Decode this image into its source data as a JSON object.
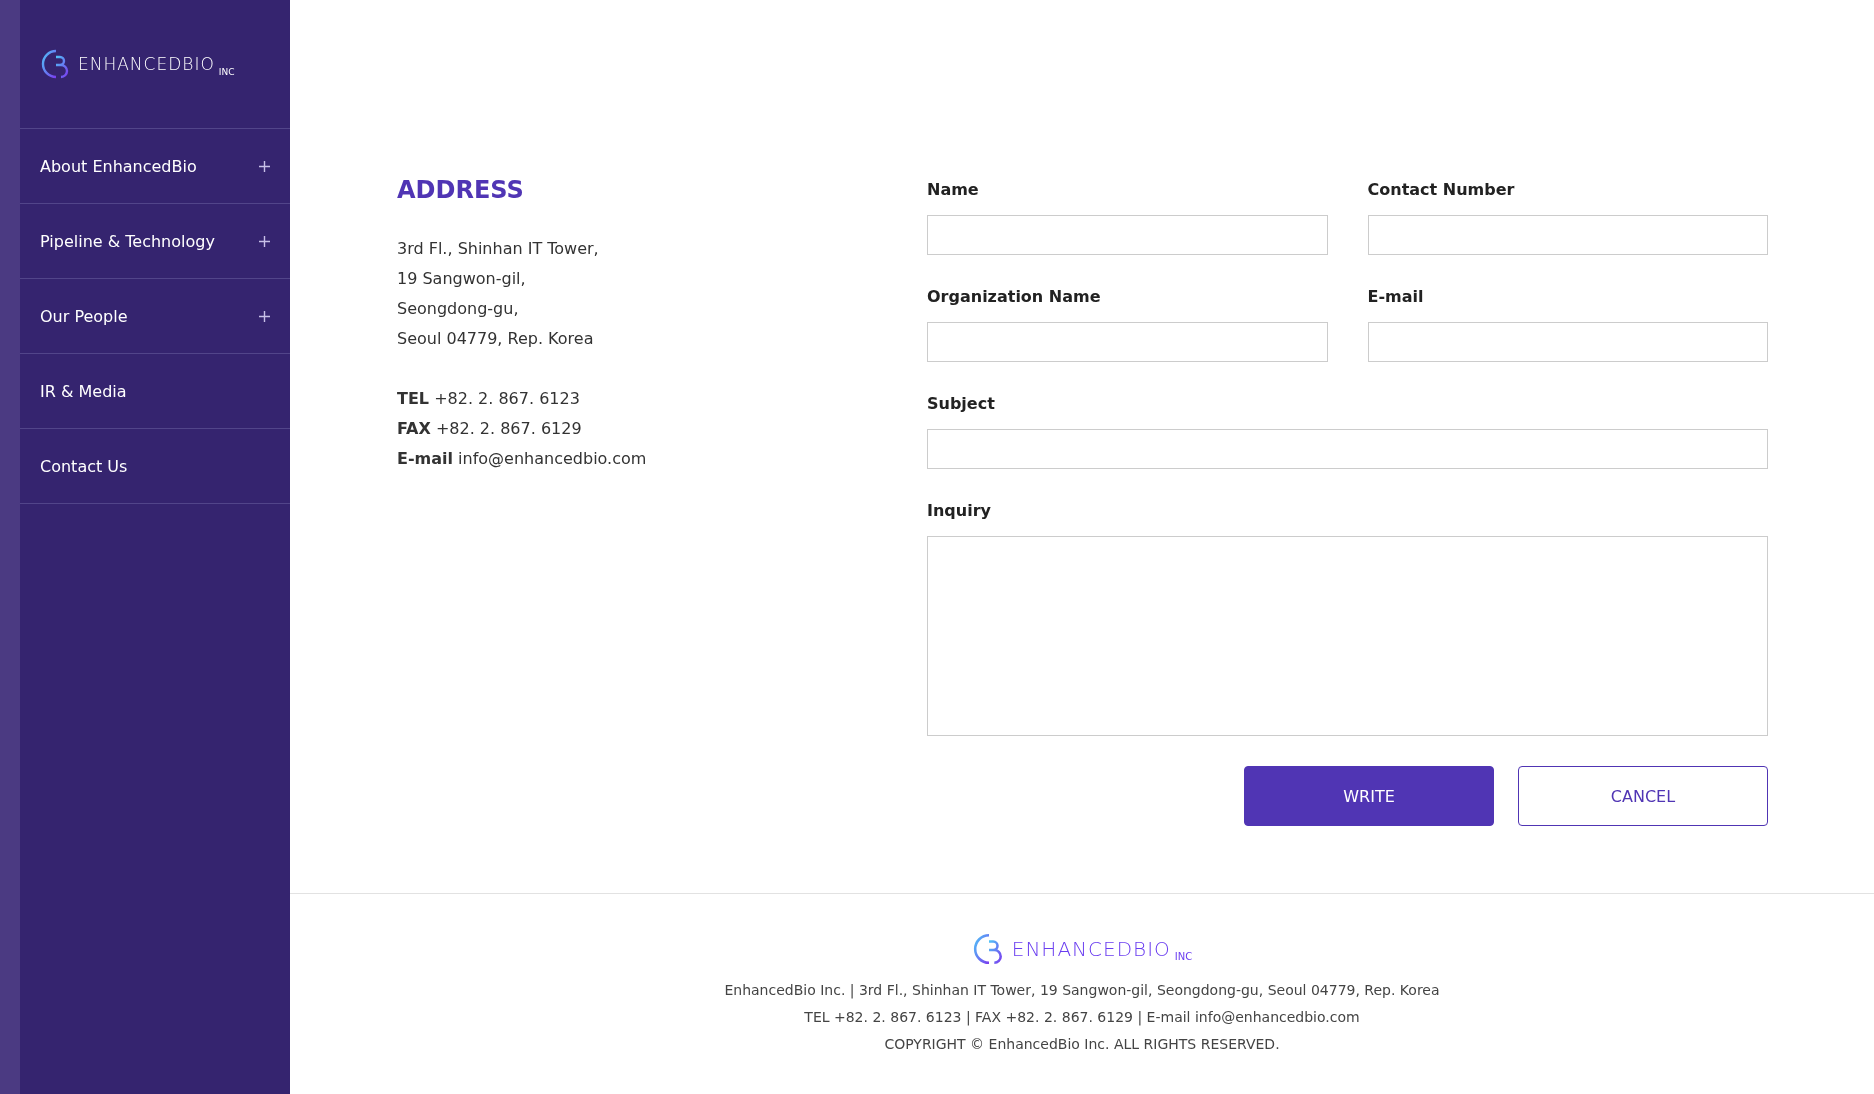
{
  "sidebar": {
    "logo": {
      "name": "ENHANCEDBIO",
      "suffix": "INC"
    },
    "items": [
      {
        "label": "About EnhancedBio",
        "expandable": true
      },
      {
        "label": "Pipeline & Technology",
        "expandable": true
      },
      {
        "label": "Our People",
        "expandable": true
      },
      {
        "label": "IR & Media",
        "expandable": false
      },
      {
        "label": "Contact Us",
        "expandable": false
      }
    ]
  },
  "address": {
    "title": "ADDRESS",
    "lines": [
      "3rd Fl., Shinhan IT Tower,",
      "19 Sangwon-gil,",
      "Seongdong-gu,",
      "Seoul 04779, Rep. Korea"
    ],
    "contacts": [
      "**TEL** +82. 2. 867. 6123",
      "**FAX** +82. 2. 867. 6129",
      "**E-mail** info@enhancedbio.com"
    ]
  },
  "form": {
    "rows": [
      [
        {
          "label": "Name",
          "kind": "input"
        },
        {
          "label": "Contact Number",
          "kind": "input"
        }
      ],
      [
        {
          "label": "Organization Name",
          "kind": "input"
        },
        {
          "label": "E-mail",
          "kind": "input"
        }
      ],
      [
        {
          "label": "Subject",
          "kind": "input"
        }
      ],
      [
        {
          "label": "Inquiry",
          "kind": "textarea"
        }
      ]
    ],
    "buttons": [
      {
        "label": "WRITE",
        "kind": "primary"
      },
      {
        "label": "CANCEL",
        "kind": "outline"
      }
    ]
  },
  "footer": {
    "logo": {
      "name": "ENHANCEDBIO",
      "suffix": "INC"
    },
    "lines": [
      "EnhancedBio Inc. | 3rd Fl., Shinhan IT Tower, 19 Sangwon-gil, Seongdong-gu, Seoul 04779, Rep. Korea",
      "TEL +82. 2. 867. 6123 | FAX +82. 2. 867. 6129 | E-mail info@enhancedbio.com",
      "COPYRIGHT © EnhancedBio Inc. ALL RIGHTS RESERVED."
    ]
  }
}
